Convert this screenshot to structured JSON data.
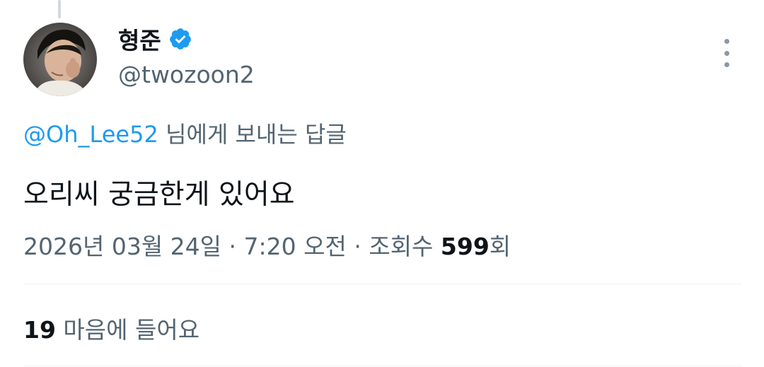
{
  "author": {
    "display_name": "형준",
    "handle": "@twozoon2",
    "verified": true
  },
  "reply": {
    "mention": "@Oh_Lee52",
    "suffix": " 님에게 보내는 답글"
  },
  "tweet": {
    "text": "오리씨 궁금한게 있어요"
  },
  "meta": {
    "date": "2026년 03월 24일",
    "separator": " · ",
    "time": "7:20 오전",
    "views_label": "조회수 ",
    "views_count": "599",
    "views_suffix": "회"
  },
  "stats": {
    "likes_count": "19",
    "likes_label": " 마음에 들어요"
  },
  "colors": {
    "accent": "#1d9bf0",
    "text_primary": "#0f1419",
    "text_secondary": "#536471"
  }
}
